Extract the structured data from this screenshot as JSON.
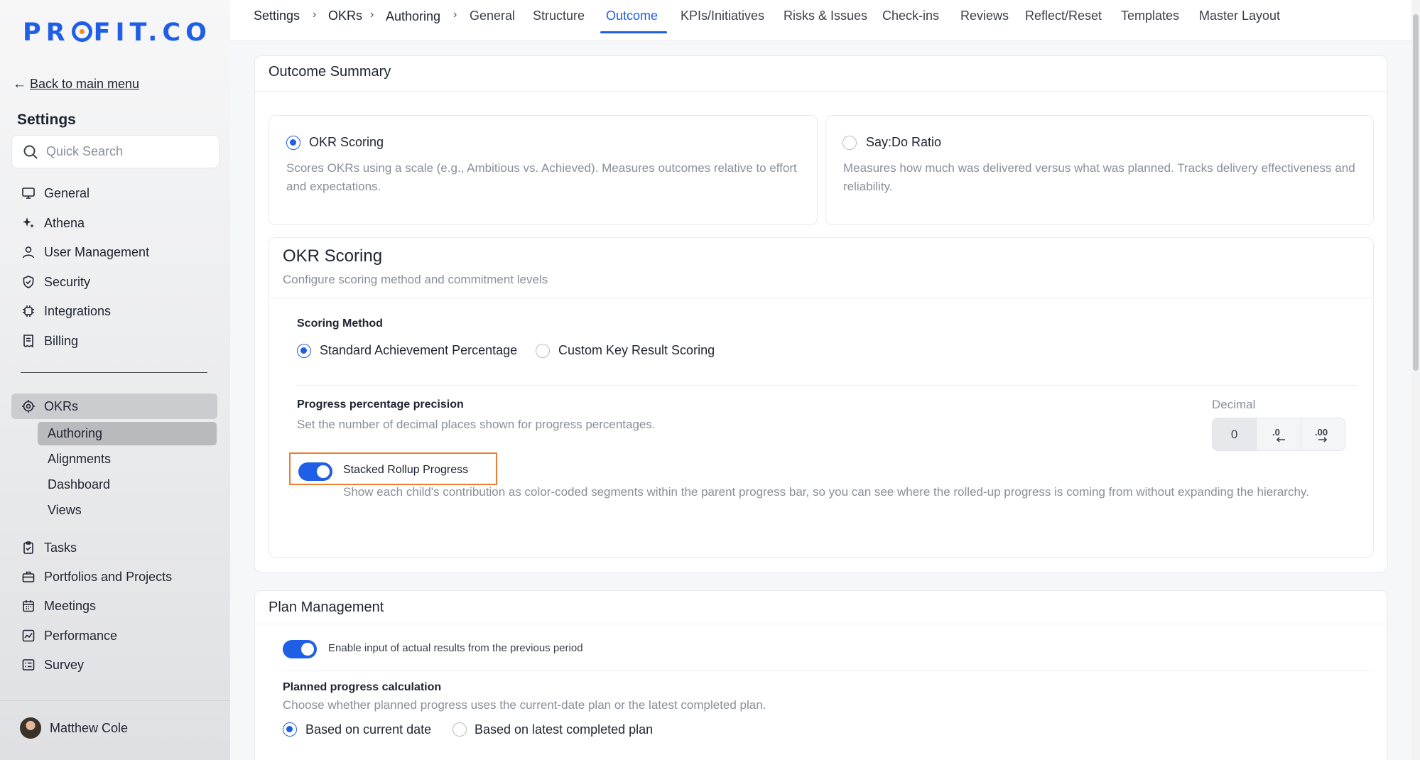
{
  "brand": {
    "logo_left": "PR",
    "logo_right": "FIT.CO",
    "accent": "#1f5fe6",
    "logo_dot": "#f28a24"
  },
  "sidebar": {
    "back_arrow": "←",
    "back_label": "Back to main menu",
    "title": "Settings",
    "search_placeholder": "Quick Search",
    "items": [
      {
        "label": "General",
        "icon": "monitor-icon"
      },
      {
        "label": "Athena",
        "icon": "sparkle-icon"
      },
      {
        "label": "User Management",
        "icon": "user-icon"
      },
      {
        "label": "Security",
        "icon": "shield-icon"
      },
      {
        "label": "Integrations",
        "icon": "chip-icon"
      },
      {
        "label": "Billing",
        "icon": "receipt-icon"
      }
    ],
    "okrs": {
      "label": "OKRs",
      "icon": "target-icon",
      "children": [
        "Authoring",
        "Alignments",
        "Dashboard",
        "Views"
      ],
      "active_child": "Authoring"
    },
    "items_bottom": [
      {
        "label": "Tasks",
        "icon": "clipboard-check-icon"
      },
      {
        "label": "Portfolios and Projects",
        "icon": "briefcase-icon"
      },
      {
        "label": "Meetings",
        "icon": "calendar-icon"
      },
      {
        "label": "Performance",
        "icon": "chart-icon"
      },
      {
        "label": "Survey",
        "icon": "list-icon"
      }
    ],
    "user": {
      "name": "Matthew Cole"
    }
  },
  "topnav": {
    "breadcrumb": [
      "Settings",
      "OKRs",
      "Authoring"
    ],
    "separator": "›",
    "tabs": [
      "General",
      "Structure",
      "Outcome",
      "KPIs/Initiatives",
      "Risks & Issues",
      "Check-ins",
      "Reviews",
      "Reflect/Reset",
      "Templates",
      "Master Layout"
    ],
    "active_tab": "Outcome"
  },
  "outcome_summary": {
    "title": "Outcome Summary",
    "options": [
      {
        "label": "OKR Scoring",
        "selected": true,
        "description": "Scores OKRs using a scale (e.g., Ambitious vs. Achieved). Measures outcomes relative to effort and expectations."
      },
      {
        "label": "Say:Do Ratio",
        "selected": false,
        "description": "Measures how much was delivered versus what was planned. Tracks delivery effectiveness and reliability."
      }
    ]
  },
  "okr_scoring": {
    "title": "OKR Scoring",
    "subtitle": "Configure scoring method and commitment levels",
    "scoring_method": {
      "label": "Scoring Method",
      "options": [
        {
          "label": "Standard Achievement Percentage",
          "selected": true
        },
        {
          "label": "Custom Key Result Scoring",
          "selected": false
        }
      ]
    },
    "precision": {
      "label": "Progress percentage precision",
      "description": "Set the number of decimal places shown for progress percentages.",
      "decimal_label": "Decimal",
      "value": "0",
      "decrease_icon": "decrease-decimal-icon",
      "increase_icon": "increase-decimal-icon"
    },
    "stacked_rollup": {
      "label": "Stacked Rollup Progress",
      "enabled": true,
      "description": "Show each child's contribution as color-coded segments within the parent progress bar, so you can see where the rolled-up progress is coming from without expanding the hierarchy."
    }
  },
  "plan_management": {
    "title": "Plan Management",
    "previous_period": {
      "label": "Enable input of actual results from the previous period",
      "enabled": true
    },
    "planned_progress": {
      "label": "Planned progress calculation",
      "description": "Choose whether planned progress uses the current-date plan or the latest completed plan.",
      "options": [
        {
          "label": "Based on current date",
          "selected": true
        },
        {
          "label": "Based on latest completed plan",
          "selected": false
        }
      ]
    }
  }
}
